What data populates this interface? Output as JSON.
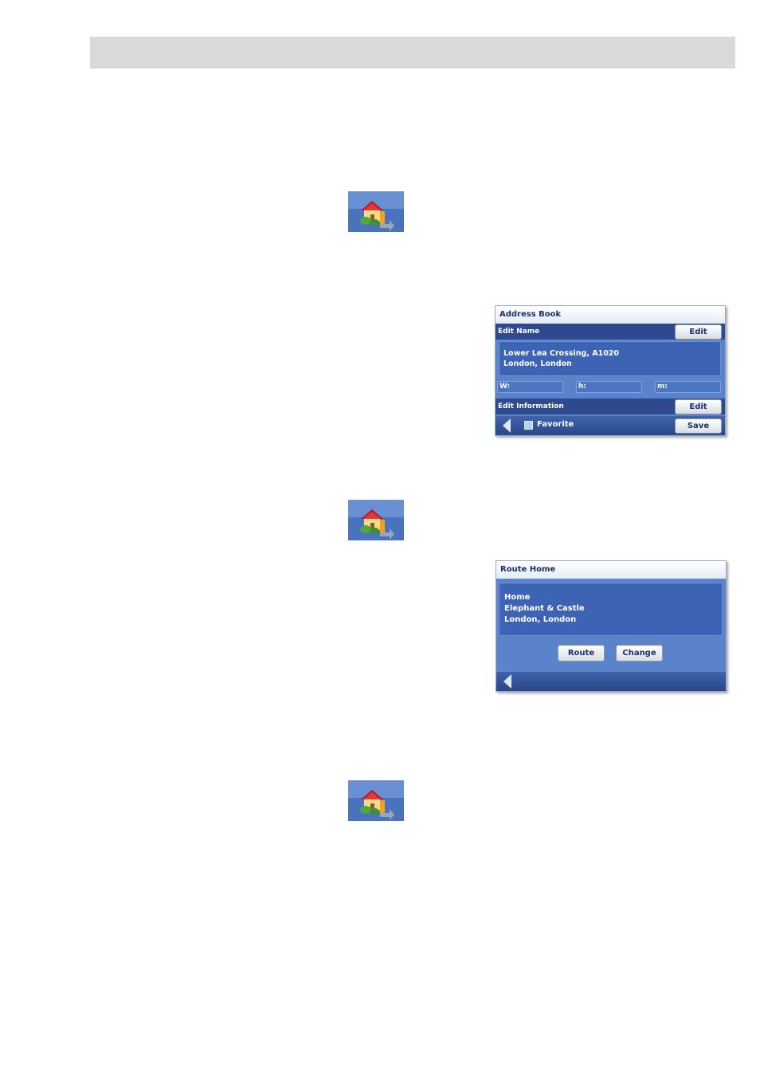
{
  "colors": {
    "header_bar": "#d9d9d9",
    "screen_bg": "#5b83c9",
    "screen_dark": "#2d4a8f",
    "title_text": "#1c2f6b"
  },
  "icons": [
    "home-icon",
    "home-icon",
    "home-icon",
    "back-arrow-icon"
  ],
  "address_book": {
    "title": "Address Book",
    "edit_name_label": "Edit Name",
    "edit_name_button": "Edit",
    "address_line1": "Lower Lea Crossing, A1020",
    "address_line2": "London, London",
    "field_w": "W:",
    "field_h": "h:",
    "field_m": "m:",
    "edit_info_label": "Edit Information",
    "edit_info_button": "Edit",
    "favorite_label": "Favorite",
    "save_button": "Save"
  },
  "route_home": {
    "title": "Route Home",
    "line1": "Home",
    "line2": "Elephant & Castle",
    "line3": "London, London",
    "route_button": "Route",
    "change_button": "Change"
  }
}
